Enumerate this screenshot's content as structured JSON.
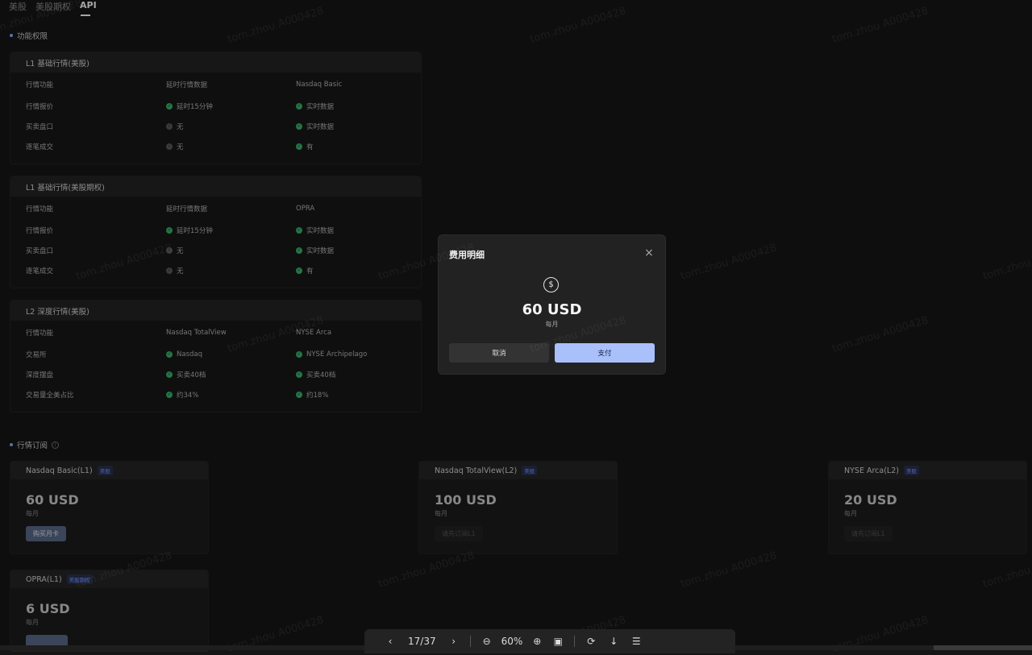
{
  "tabs": [
    "美股",
    "美股期权",
    "API"
  ],
  "permissions_section": {
    "title": "功能权限"
  },
  "tables": [
    {
      "title": "L1 基础行情(美股)",
      "columns": [
        "行情功能",
        "延时行情数据",
        "Nasdaq Basic"
      ],
      "rows": [
        {
          "feature": "行情报价",
          "a": "延时15分钟",
          "a_ok": true,
          "b": "实时数据",
          "b_ok": true
        },
        {
          "feature": "买卖盘口",
          "a": "无",
          "a_ok": false,
          "b": "实时数据",
          "b_ok": true
        },
        {
          "feature": "逐笔成交",
          "a": "无",
          "a_ok": false,
          "b": "有",
          "b_ok": true
        }
      ]
    },
    {
      "title": "L1 基础行情(美股期权)",
      "columns": [
        "行情功能",
        "延时行情数据",
        "OPRA"
      ],
      "rows": [
        {
          "feature": "行情报价",
          "a": "延时15分钟",
          "a_ok": true,
          "b": "实时数据",
          "b_ok": true
        },
        {
          "feature": "买卖盘口",
          "a": "无",
          "a_ok": false,
          "b": "实时数据",
          "b_ok": true
        },
        {
          "feature": "逐笔成交",
          "a": "无",
          "a_ok": false,
          "b": "有",
          "b_ok": true
        }
      ]
    },
    {
      "title": "L2 深度行情(美股)",
      "columns": [
        "行情功能",
        "Nasdaq TotalView",
        "NYSE Arca"
      ],
      "rows": [
        {
          "feature": "交易所",
          "a": "Nasdaq",
          "a_ok": true,
          "b": "NYSE Archipelago",
          "b_ok": true
        },
        {
          "feature": "深度摆盘",
          "a": "买卖40档",
          "a_ok": true,
          "b": "买卖40档",
          "b_ok": true
        },
        {
          "feature": "交易量全美占比",
          "a": "约34%",
          "a_ok": true,
          "b": "约18%",
          "b_ok": true
        }
      ]
    }
  ],
  "subscription_section": {
    "title": "行情订阅"
  },
  "cards": [
    {
      "name": "Nasdaq Basic(L1)",
      "tag": "美股",
      "price": "60 USD",
      "period": "每月",
      "button": "购买月卡",
      "enabled": true
    },
    {
      "name": "Nasdaq TotalView(L2)",
      "tag": "美股",
      "price": "100 USD",
      "period": "每月",
      "button": "请先订阅L1",
      "enabled": false
    },
    {
      "name": "NYSE Arca(L2)",
      "tag": "美股",
      "price": "20 USD",
      "period": "每月",
      "button": "请先订阅L1",
      "enabled": false
    },
    {
      "name": "OPRA(L1)",
      "tag": "美股期权",
      "price": "6 USD",
      "period": "每月",
      "button": "",
      "enabled": true
    }
  ],
  "dialog": {
    "title": "费用明细",
    "amount": "60 USD",
    "period": "每月",
    "cancel_label": "取消",
    "pay_label": "支付"
  },
  "watermark": "tom.zhou A000428",
  "viewer": {
    "page": "17/37",
    "zoom": "60%"
  },
  "colors": {
    "accent": "#aac0fa",
    "success": "#39b36b",
    "background": "#161616"
  }
}
